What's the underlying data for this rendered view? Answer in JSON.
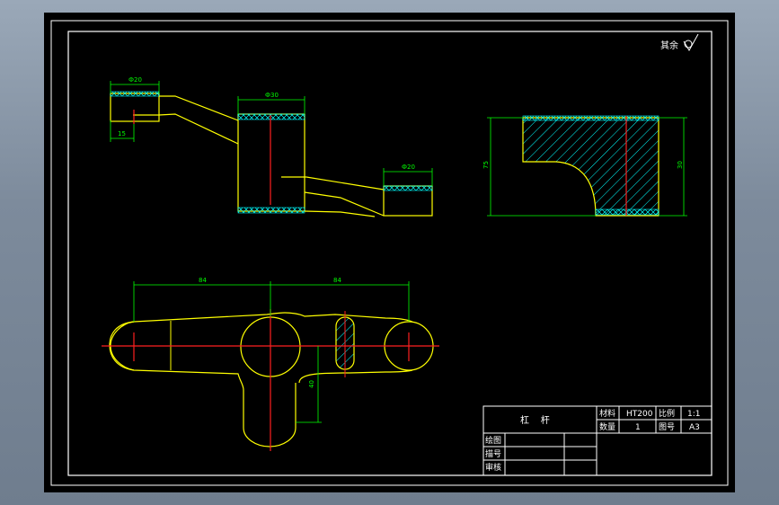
{
  "drawing": {
    "roughness_note": "其余",
    "dims": {
      "d1": "Ф20",
      "d2": "15",
      "d3": "Ф30",
      "d4": "Ф20",
      "d5": "75",
      "d6": "30",
      "d7": "84",
      "d8": "84",
      "d9": "40"
    }
  },
  "title_block": {
    "part_name": "杠    杆",
    "material_label": "材料",
    "material_value": "HT200",
    "scale_label": "比例",
    "scale_value": "1:1",
    "qty_label": "数量",
    "qty_value": "1",
    "sheet_label": "图号",
    "sheet_value": "A3",
    "drawn_label": "绘图",
    "design_label": "描号",
    "check_label": "审核"
  },
  "colors": {
    "outline": "#ffff00",
    "centerline": "#ff2020",
    "dimension": "#00ff00",
    "hatch": "#00ffff",
    "frame": "#ffffff"
  }
}
